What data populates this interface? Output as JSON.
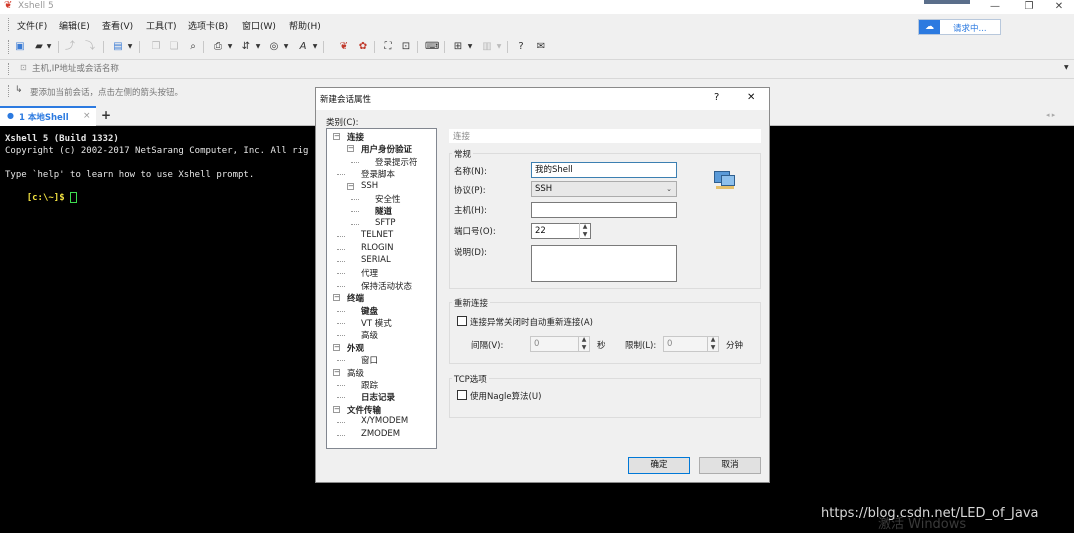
{
  "window": {
    "title": "Xshell 5",
    "minimize": "—",
    "restore": "❐",
    "close": "✕"
  },
  "menu": [
    "文件(F)",
    "编辑(E)",
    "查看(V)",
    "工具(T)",
    "选项卡(B)",
    "窗口(W)",
    "帮助(H)"
  ],
  "cloud_button": {
    "label": "请求中..."
  },
  "address": {
    "placeholder": "主机,IP地址或会话名称"
  },
  "hint": {
    "text": "要添加当前会话，点击左侧的箭头按钮。"
  },
  "tab": {
    "label": "1 本地Shell",
    "close": "×",
    "add": "+"
  },
  "terminal": {
    "lines": [
      "Xshell 5 (Build 1332)",
      "Copyright (c) 2002-2017 NetSarang Computer, Inc. All rig",
      "",
      "Type `help' to learn how to use Xshell prompt.",
      "[c:\\~]$ "
    ]
  },
  "dialog": {
    "title": "新建会话属性",
    "help": "?",
    "close": "✕",
    "category_label": "类别(C):",
    "tree": [
      {
        "label": "连接",
        "bold": true
      },
      {
        "label": "用户身份验证",
        "bold": true
      },
      {
        "label": "登录提示符",
        "bold": false
      },
      {
        "label": "登录脚本",
        "bold": false
      },
      {
        "label": "SSH",
        "bold": false
      },
      {
        "label": "安全性",
        "bold": false
      },
      {
        "label": "隧道",
        "bold": true
      },
      {
        "label": "SFTP",
        "bold": false
      },
      {
        "label": "TELNET",
        "bold": false
      },
      {
        "label": "RLOGIN",
        "bold": false
      },
      {
        "label": "SERIAL",
        "bold": false
      },
      {
        "label": "代理",
        "bold": false
      },
      {
        "label": "保持活动状态",
        "bold": false
      },
      {
        "label": "终端",
        "bold": true
      },
      {
        "label": "键盘",
        "bold": true
      },
      {
        "label": "VT 模式",
        "bold": false
      },
      {
        "label": "高级",
        "bold": false
      },
      {
        "label": "外观",
        "bold": true
      },
      {
        "label": "窗口",
        "bold": false
      },
      {
        "label": "高级",
        "bold": false
      },
      {
        "label": "跟踪",
        "bold": false
      },
      {
        "label": "日志记录",
        "bold": true
      },
      {
        "label": "文件传输",
        "bold": true
      },
      {
        "label": "X/YMODEM",
        "bold": false
      },
      {
        "label": "ZMODEM",
        "bold": false
      }
    ],
    "section_title": "连接",
    "general": {
      "title": "常规",
      "name_label": "名称(N):",
      "name_value": "我的Shell",
      "protocol_label": "协议(P):",
      "protocol_value": "SSH",
      "host_label": "主机(H):",
      "host_value": "",
      "port_label": "端口号(O):",
      "port_value": "22",
      "desc_label": "说明(D):",
      "desc_value": ""
    },
    "reconnect": {
      "title": "重新连接",
      "auto_label": "连接异常关闭时自动重新连接(A)",
      "interval_label": "间隔(V):",
      "interval_value": "0",
      "interval_unit": "秒",
      "limit_label": "限制(L):",
      "limit_value": "0",
      "limit_unit": "分钟"
    },
    "tcp": {
      "title": "TCP选项",
      "nagle_label": "使用Nagle算法(U)"
    },
    "ok": "确定",
    "cancel": "取消"
  },
  "watermark": {
    "activate": "激活 Windows",
    "url": "https://blog.csdn.net/LED_of_Java"
  }
}
